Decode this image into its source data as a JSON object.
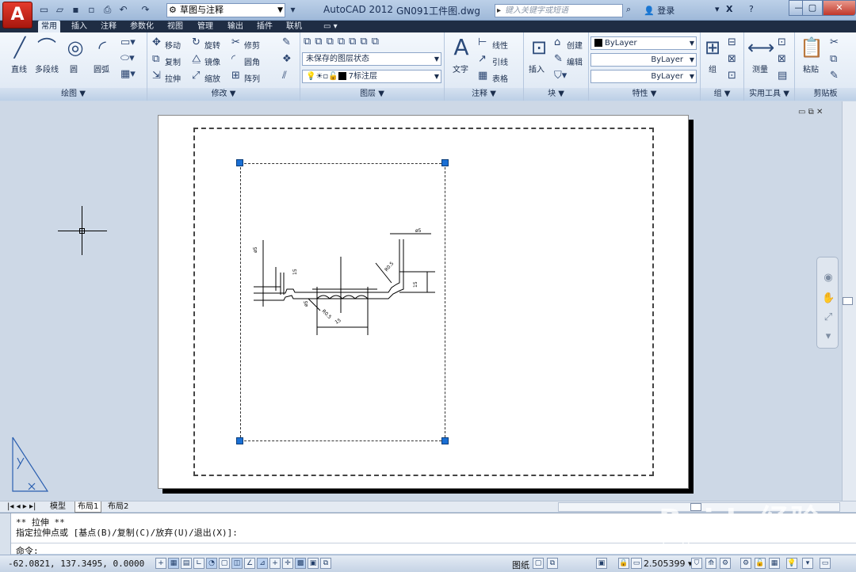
{
  "titlebar": {
    "workspace": "草图与注释",
    "app_name": "AutoCAD 2012",
    "file_name": "GN091工件图.dwg",
    "search_placeholder": "键入关键字或短语",
    "login": "登录"
  },
  "tabs": [
    "常用",
    "插入",
    "注释",
    "参数化",
    "视图",
    "管理",
    "输出",
    "插件",
    "联机"
  ],
  "active_tab": "常用",
  "ribbon": {
    "draw": {
      "title": "绘图 ▼",
      "line": "直线",
      "polyline": "多段线",
      "circle": "圆",
      "arc": "圆弧"
    },
    "modify": {
      "title": "修改 ▼",
      "move": "移动",
      "rotate": "旋转",
      "trim": "修剪",
      "copy": "复制",
      "mirror": "镜像",
      "fillet": "圆角",
      "stretch": "拉伸",
      "scale": "缩放",
      "array": "阵列"
    },
    "layers": {
      "title": "图层 ▼",
      "state": "未保存的图层状态",
      "current_layer": "7标注层"
    },
    "annotation": {
      "title": "注释 ▼",
      "text": "文字",
      "linear": "线性",
      "leader": "引线",
      "table": "表格"
    },
    "block": {
      "title": "块 ▼",
      "insert": "插入",
      "create": "创建",
      "edit": "编辑"
    },
    "properties": {
      "title": "特性 ▼",
      "color": "ByLayer",
      "linetype": "ByLayer",
      "lineweight": "ByLayer"
    },
    "group": {
      "title": "组 ▼",
      "group": "组"
    },
    "utilities": {
      "title": "实用工具 ▼",
      "measure": "测量"
    },
    "clipboard": {
      "title": "剪贴板",
      "paste": "粘贴"
    }
  },
  "drawing": {
    "dims": [
      "ø5",
      "15",
      "R0.5",
      "R0.5",
      "15",
      "15",
      "ø5",
      "ø5"
    ]
  },
  "layout_tabs": [
    "模型",
    "布局1",
    "布局2"
  ],
  "active_layout": "布局1",
  "command": {
    "line1": "** 拉伸 **",
    "line2": "指定拉伸点或 [基点(B)/复制(C)/放弃(U)/退出(X)]:",
    "prompt": "命令:"
  },
  "status": {
    "coords": "-62.0821, 137.3495, 0.0000",
    "paper": "图纸",
    "scale": "2.505399"
  },
  "watermark": {
    "brand": "Baidu经验",
    "url": "jingyan.baidu.com"
  }
}
